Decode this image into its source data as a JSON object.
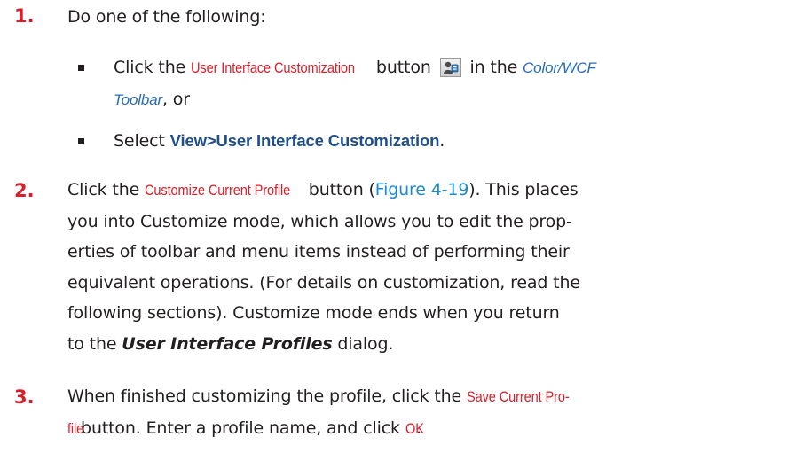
{
  "steps": [
    {
      "number": "1.",
      "intro": "Do one of the following:",
      "options": [
        {
          "pre": "Click the ",
          "ui_name": "User Interface Customization",
          "mid": " button",
          "icon": "user-interface-customization-icon",
          "post": " in the ",
          "toolbar_a": "Color/WCF",
          "toolbar_b": "Toolbar",
          "end": ", or"
        },
        {
          "pre": "Select ",
          "menu_path": "View>User Interface Customization",
          "end": "."
        }
      ]
    },
    {
      "number": "2.",
      "pre": "Click the ",
      "ui_name": "Customize Current Profile",
      "mid": " button (",
      "figure_ref": "Figure 4-19",
      "text_a": "). This places",
      "line2": "you into Customize mode, which allows you to edit the prop-",
      "line3": "erties of toolbar and menu items instead of performing their",
      "line4": "equivalent operations. (For details on customization, read the",
      "line5": "following sections). Customize mode ends when you return",
      "line6_pre": "to the ",
      "dialog_name": "User Interface Profiles",
      "line6_post": " dialog."
    },
    {
      "number": "3.",
      "pre": "When finished customizing the profile, click the ",
      "ui_name_a": "Save Current Pro-",
      "ui_name_b": "file",
      "post": " button. Enter a profile name, and click ",
      "ok": "OK",
      "end": "."
    }
  ],
  "colors": {
    "step_number": "#d6202b",
    "ui_element": "#d6202b",
    "toolbar_name": "#2a6cb5",
    "menu_path": "#1f4e8c",
    "cross_reference": "#1a8bd0",
    "body_text": "#231f20"
  }
}
